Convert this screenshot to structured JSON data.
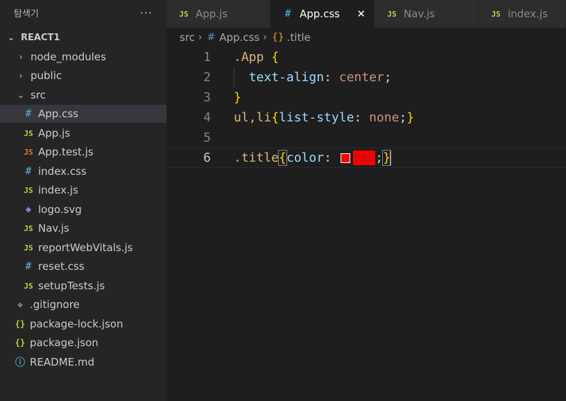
{
  "explorer": {
    "title": "탐색기",
    "more": "···",
    "root": "REACT1",
    "items": [
      {
        "label": "node_modules",
        "kind": "folder",
        "chevron": "›"
      },
      {
        "label": "public",
        "kind": "folder",
        "chevron": "›"
      },
      {
        "label": "src",
        "kind": "folder-open",
        "chevron": "⌄"
      },
      {
        "label": "App.css",
        "icon": "#",
        "selected": true
      },
      {
        "label": "App.js",
        "icon": "JS"
      },
      {
        "label": "App.test.js",
        "icon": "JS"
      },
      {
        "label": "index.css",
        "icon": "#"
      },
      {
        "label": "index.js",
        "icon": "JS"
      },
      {
        "label": "logo.svg",
        "icon": "◆"
      },
      {
        "label": "Nav.js",
        "icon": "JS"
      },
      {
        "label": "reportWebVitals.js",
        "icon": "JS"
      },
      {
        "label": "reset.css",
        "icon": "#"
      },
      {
        "label": "setupTests.js",
        "icon": "JS"
      },
      {
        "label": ".gitignore",
        "icon": "◆"
      },
      {
        "label": "package-lock.json",
        "icon": "{}"
      },
      {
        "label": "package.json",
        "icon": "{}"
      },
      {
        "label": "README.md",
        "icon": "ⓘ"
      }
    ]
  },
  "tabs": [
    {
      "label": "App.js",
      "icon": "JS",
      "active": false
    },
    {
      "label": "App.css",
      "icon": "#",
      "active": true,
      "close": "✕"
    },
    {
      "label": "Nav.js",
      "icon": "JS",
      "active": false
    },
    {
      "label": "index.js",
      "icon": "JS",
      "active": false
    }
  ],
  "breadcrumb": {
    "folder": "src",
    "sep": "›",
    "file_icon": "#",
    "file": "App.css",
    "symbol_icon": "{}",
    "symbol": ".title"
  },
  "editor": {
    "line_numbers": [
      "1",
      "2",
      "3",
      "4",
      "5",
      "6"
    ],
    "current_line": "6",
    "lines": {
      "l1": {
        "selector": ".App",
        "brace_open": "{"
      },
      "l2": {
        "property": "text-align",
        "colon": ":",
        "value": "center",
        "semi": ";"
      },
      "l3": {
        "brace_close": "}"
      },
      "l4": {
        "selector": "ul,li",
        "brace_open": "{",
        "property": "list-style",
        "colon": ":",
        "value": "none",
        "semi": ";",
        "brace_close": "}"
      },
      "l6": {
        "selector": ".title",
        "brace_open": "{",
        "property": "color",
        "colon": ":",
        "value": "red",
        "semi": ";",
        "brace_close": "}"
      }
    }
  },
  "colors": {
    "selector": "#d7ba7d",
    "brace": "#ffd700",
    "property": "#9cdcfe",
    "value": "#ce9178",
    "swatch": "#ff0000"
  }
}
